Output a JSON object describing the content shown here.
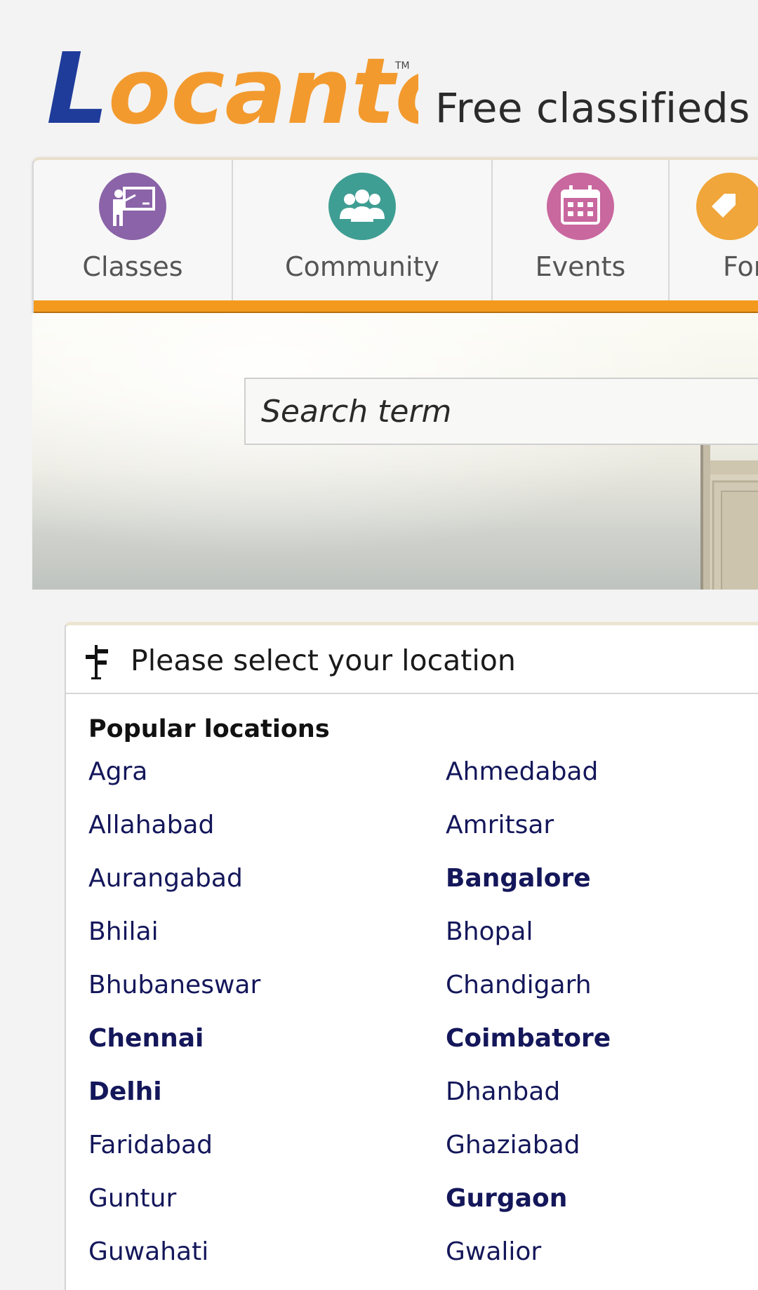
{
  "header": {
    "logo_text": "Locanto",
    "trademark": "TM",
    "tagline": "Free classifieds"
  },
  "categories": [
    {
      "label": "Classes",
      "icon": "teacher-board-icon",
      "color": "#8a63a8"
    },
    {
      "label": "Community",
      "icon": "people-group-icon",
      "color": "#3f9e93"
    },
    {
      "label": "Events",
      "icon": "calendar-icon",
      "color": "#c9679f"
    },
    {
      "label": "For",
      "icon": "for-sale-icon",
      "color": "#f0a63a"
    }
  ],
  "search": {
    "placeholder": "Search term"
  },
  "location": {
    "title": "Please select your location",
    "popular_title": "Popular locations",
    "cities": [
      {
        "name": "Agra",
        "bold": false
      },
      {
        "name": "Ahmedabad",
        "bold": false
      },
      {
        "name": "Allahabad",
        "bold": false
      },
      {
        "name": "Amritsar",
        "bold": false
      },
      {
        "name": "Aurangabad",
        "bold": false
      },
      {
        "name": "Bangalore",
        "bold": true
      },
      {
        "name": "Bhilai",
        "bold": false
      },
      {
        "name": "Bhopal",
        "bold": false
      },
      {
        "name": "Bhubaneswar",
        "bold": false
      },
      {
        "name": "Chandigarh",
        "bold": false
      },
      {
        "name": "Chennai",
        "bold": true
      },
      {
        "name": "Coimbatore",
        "bold": true
      },
      {
        "name": "Delhi",
        "bold": true
      },
      {
        "name": "Dhanbad",
        "bold": false
      },
      {
        "name": "Faridabad",
        "bold": false
      },
      {
        "name": "Ghaziabad",
        "bold": false
      },
      {
        "name": "Guntur",
        "bold": false
      },
      {
        "name": "Gurgaon",
        "bold": true
      },
      {
        "name": "Guwahati",
        "bold": false
      },
      {
        "name": "Gwalior",
        "bold": false
      }
    ]
  },
  "colors": {
    "accent_orange": "#f39a1e",
    "link_navy": "#14175a",
    "logo_blue": "#1f3c9a",
    "logo_orange": "#f39a2e"
  }
}
